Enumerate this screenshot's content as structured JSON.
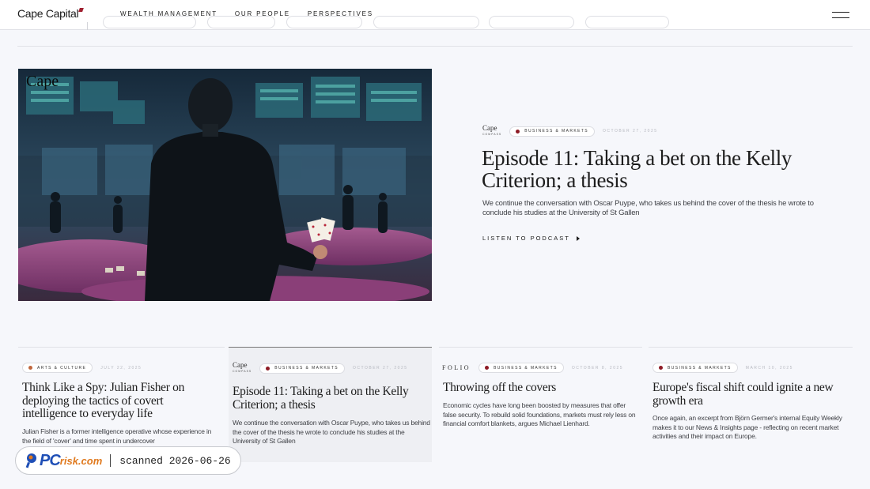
{
  "header": {
    "logo": "Cape Capital",
    "nav": [
      "WEALTH MANAGEMENT",
      "OUR PEOPLE",
      "PERSPECTIVES"
    ]
  },
  "hero": {
    "image_overlay_logo": "Cape",
    "mini_logo": "Cape",
    "mini_logo_sub": "COMPASS",
    "tag": "BUSINESS & MARKETS",
    "date": "OCTOBER 27, 2025",
    "title": "Episode 11: Taking a bet on the Kelly Criterion; a thesis",
    "description": "We continue the conversation with Oscar Puype, who takes us behind the cover of the thesis he wrote to conclude his studies at the University of St Gallen",
    "cta": "LISTEN TO PODCAST"
  },
  "cards": [
    {
      "tag": "ARTS & CULTURE",
      "date": "JULY 22, 2025",
      "title": "Think Like a Spy: Julian Fisher on deploying the tactics of covert intelligence to everyday life",
      "description": "Julian Fisher is a former intelligence operative whose experience in the field of 'cover' and time spent in undercover"
    },
    {
      "mini_logo": "Cape",
      "mini_logo_sub": "COMPASS",
      "tag": "BUSINESS & MARKETS",
      "date": "OCTOBER 27, 2025",
      "title": "Episode 11: Taking a bet on the Kelly Criterion; a thesis",
      "description": "We continue the conversation with Oscar Puype, who takes us behind the cover of the thesis he wrote to conclude his studies at the University of St Gallen"
    },
    {
      "source": "FOLIO",
      "tag": "BUSINESS & MARKETS",
      "date": "OCTOBER 8, 2025",
      "title": "Throwing off the covers",
      "description": "Economic cycles have long been boosted by measures that offer false security. To rebuild solid foundations, markets must rely less on financial comfort blankets, argues Michael Lienhard."
    },
    {
      "tag": "BUSINESS & MARKETS",
      "date": "MARCH 10, 2025",
      "title": "Europe's fiscal shift could ignite a new growth era",
      "description": "Once again, an excerpt from Björn Germer's internal Equity Weekly makes it to our News & Insights page - reflecting on recent market activities and their impact on Europe."
    }
  ],
  "watermark": {
    "brand_pc": "PC",
    "brand_risk": "risk.com",
    "scan_text": "scanned 2026-06-26"
  },
  "colors": {
    "accent": "#8e1b25",
    "background": "#f6f7fb"
  }
}
